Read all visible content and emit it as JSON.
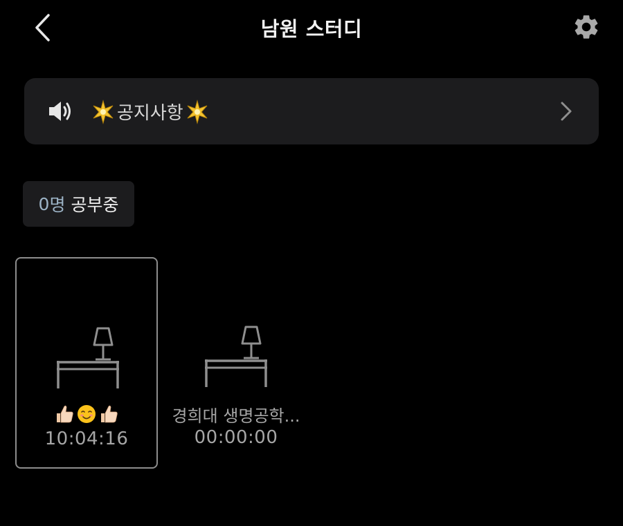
{
  "header": {
    "title": "남원 스터디",
    "back_icon": "chevron-left-icon",
    "settings_icon": "gear-icon"
  },
  "notice": {
    "icon": "speaker-icon",
    "label": "공지사항",
    "decoration": "sparkle-emoji",
    "chevron": "chevron-right-icon"
  },
  "studying": {
    "count": "0",
    "unit": "명",
    "label": "공부중"
  },
  "desks": [
    {
      "name_emoji": [
        "thumbs-up-emoji",
        "smiling-face-emoji",
        "thumbs-up-emoji"
      ],
      "time": "10:04:16",
      "selected": true
    },
    {
      "name": "경희대 생명공학...",
      "time": "00:00:00",
      "selected": false
    }
  ],
  "colors": {
    "background": "#000000",
    "card": "#1c1c1e",
    "muted_text": "#a6a6a6",
    "count_accent": "#9cb3c6",
    "icon_gray": "#8f8f8f"
  }
}
